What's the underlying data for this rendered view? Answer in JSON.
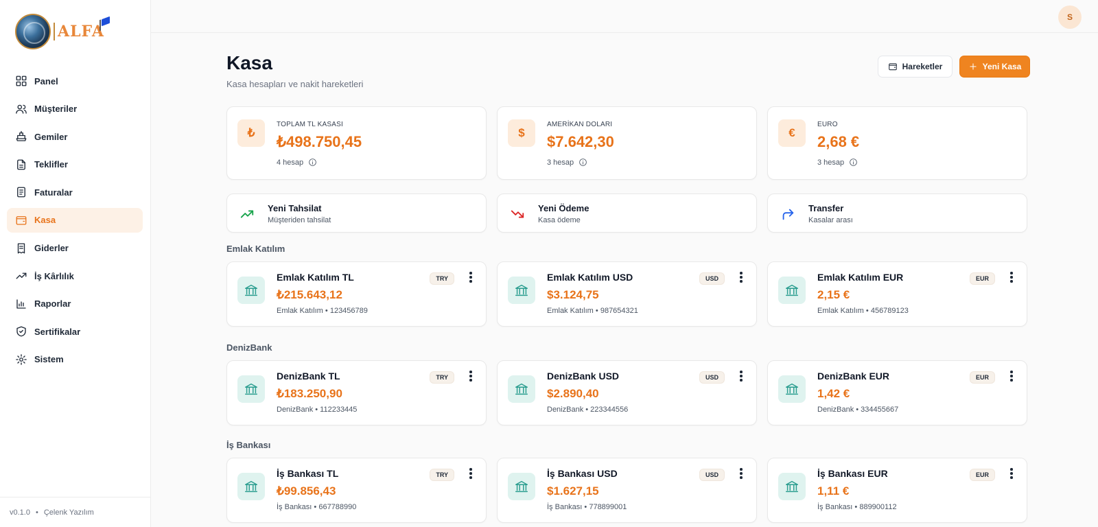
{
  "app": {
    "logo_text": "ALFA",
    "version": "v0.1.0",
    "company": "Çelenk Yazılım",
    "user_initial": "S"
  },
  "sidebar": {
    "items": [
      {
        "label": "Panel",
        "icon": "grid-icon"
      },
      {
        "label": "Müşteriler",
        "icon": "users-icon"
      },
      {
        "label": "Gemiler",
        "icon": "ship-icon"
      },
      {
        "label": "Teklifler",
        "icon": "document-icon"
      },
      {
        "label": "Faturalar",
        "icon": "invoice-icon"
      },
      {
        "label": "Kasa",
        "icon": "wallet-icon",
        "active": true
      },
      {
        "label": "Giderler",
        "icon": "receipt-icon"
      },
      {
        "label": "İş Kârlılık",
        "icon": "trend-up-icon"
      },
      {
        "label": "Raporlar",
        "icon": "bar-chart-icon"
      },
      {
        "label": "Sertifikalar",
        "icon": "shield-icon"
      },
      {
        "label": "Sistem",
        "icon": "gear-icon"
      }
    ]
  },
  "header": {
    "title": "Kasa",
    "subtitle": "Kasa hesapları ve nakit hareketleri",
    "movements_label": "Hareketler",
    "new_label": "Yeni Kasa"
  },
  "summary": [
    {
      "symbol": "₺",
      "label": "TOPLAM TL KASASI",
      "value": "₺498.750,45",
      "count": "4 hesap"
    },
    {
      "symbol": "$",
      "label": "AMERİKAN DOLARI",
      "value": "$7.642,30",
      "count": "3 hesap"
    },
    {
      "symbol": "€",
      "label": "EURO",
      "value": "2,68 €",
      "count": "3 hesap"
    }
  ],
  "actions": [
    {
      "title": "Yeni Tahsilat",
      "subtitle": "Müşteriden tahsilat",
      "icon": "trend-up-icon"
    },
    {
      "title": "Yeni Ödeme",
      "subtitle": "Kasa ödeme",
      "icon": "trend-down-icon"
    },
    {
      "title": "Transfer",
      "subtitle": "Kasalar arası",
      "icon": "forward-arrow-icon"
    }
  ],
  "groups": [
    {
      "name": "Emlak Katılım",
      "accounts": [
        {
          "name": "Emlak Katılım TL",
          "balance": "₺215.643,12",
          "bank": "Emlak Katılım",
          "number": "123456789",
          "currency": "TRY"
        },
        {
          "name": "Emlak Katılım USD",
          "balance": "$3.124,75",
          "bank": "Emlak Katılım",
          "number": "987654321",
          "currency": "USD"
        },
        {
          "name": "Emlak Katılım EUR",
          "balance": "2,15 €",
          "bank": "Emlak Katılım",
          "number": "456789123",
          "currency": "EUR"
        }
      ]
    },
    {
      "name": "DenizBank",
      "accounts": [
        {
          "name": "DenizBank TL",
          "balance": "₺183.250,90",
          "bank": "DenizBank",
          "number": "112233445",
          "currency": "TRY"
        },
        {
          "name": "DenizBank USD",
          "balance": "$2.890,40",
          "bank": "DenizBank",
          "number": "223344556",
          "currency": "USD"
        },
        {
          "name": "DenizBank EUR",
          "balance": "1,42 €",
          "bank": "DenizBank",
          "number": "334455667",
          "currency": "EUR"
        }
      ]
    },
    {
      "name": "İş Bankası",
      "accounts": [
        {
          "name": "İş Bankası TL",
          "balance": "₺99.856,43",
          "bank": "İş Bankası",
          "number": "667788990",
          "currency": "TRY"
        },
        {
          "name": "İş Bankası USD",
          "balance": "$1.627,15",
          "bank": "İş Bankası",
          "number": "778899001",
          "currency": "USD"
        },
        {
          "name": "İş Bankası EUR",
          "balance": "1,11 €",
          "bank": "İş Bankası",
          "number": "889900112",
          "currency": "EUR"
        }
      ]
    }
  ],
  "colors": {
    "accent": "#ef8420",
    "accent_soft": "#fdecdc",
    "bank_icon": "#2a9d8f",
    "bank_icon_bg": "#dff3ef",
    "trend_up": "#16a34a",
    "trend_down": "#dc2626",
    "transfer": "#2563eb"
  }
}
